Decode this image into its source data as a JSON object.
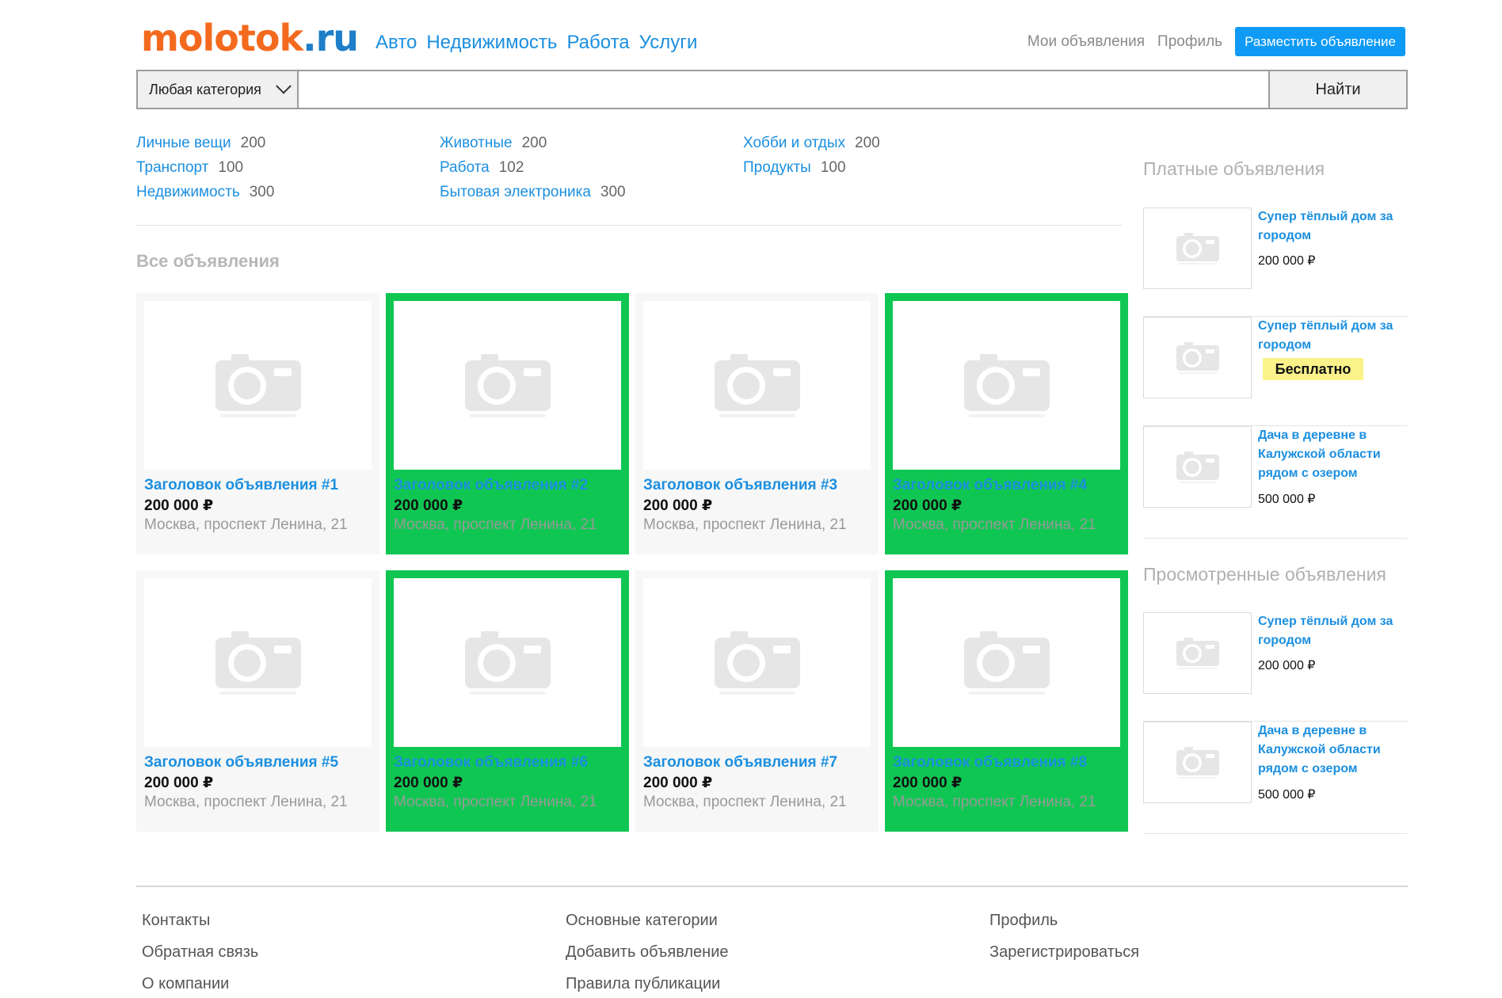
{
  "header": {
    "logo_main": "molotok",
    "logo_tld": ".ru",
    "nav": [
      "Авто",
      "Недвижимость",
      "Работа",
      "Услуги"
    ],
    "my_ads": "Мои объявления",
    "profile": "Профиль",
    "post_ad": "Разместить объявление"
  },
  "search": {
    "category": "Любая категория",
    "query": "",
    "button": "Найти"
  },
  "categories": [
    [
      {
        "name": "Личные вещи",
        "count": "200"
      },
      {
        "name": "Транспорт",
        "count": "100"
      },
      {
        "name": "Недвижимость",
        "count": "300"
      }
    ],
    [
      {
        "name": "Животные",
        "count": "200"
      },
      {
        "name": "Работа",
        "count": "102"
      },
      {
        "name": "Бытовая электроника",
        "count": "300"
      }
    ],
    [
      {
        "name": "Хобби и отдых",
        "count": "200"
      },
      {
        "name": "Продукты",
        "count": "100"
      }
    ]
  ],
  "listings_title": "Все объявления",
  "listings": [
    {
      "title": "Заголовок объявления #1",
      "price": "200 000 ₽",
      "address": "Москва, проспект Ленина, 21",
      "highlighted": false
    },
    {
      "title": "Заголовок объявления #2",
      "price": "200 000 ₽",
      "address": "Москва, проспект Ленина, 21",
      "highlighted": true
    },
    {
      "title": "Заголовок объявления #3",
      "price": "200 000 ₽",
      "address": "Москва, проспект Ленина, 21",
      "highlighted": false
    },
    {
      "title": "Заголовок объявления #4",
      "price": "200 000 ₽",
      "address": "Москва, проспект Ленина, 21",
      "highlighted": true
    },
    {
      "title": "Заголовок объявления #5",
      "price": "200 000 ₽",
      "address": "Москва, проспект Ленина, 21",
      "highlighted": false
    },
    {
      "title": "Заголовок объявления #6",
      "price": "200 000 ₽",
      "address": "Москва, проспект Ленина, 21",
      "highlighted": true
    },
    {
      "title": "Заголовок объявления #7",
      "price": "200 000 ₽",
      "address": "Москва, проспект Ленина, 21",
      "highlighted": false
    },
    {
      "title": "Заголовок объявления #8",
      "price": "200 000 ₽",
      "address": "Москва, проспект Ленина, 21",
      "highlighted": true
    }
  ],
  "sidebar": {
    "paid_title": "Платные объявления",
    "paid": [
      {
        "title": "Супер тёплый дом за городом",
        "price": "200 000 ₽"
      },
      {
        "title": "Супер тёплый дом за городом",
        "badge": "Бесплатно"
      },
      {
        "title": "Дача в деревне в Калужской области рядом с озером",
        "price": "500 000 ₽"
      }
    ],
    "viewed_title": "Просмотренные объявления",
    "viewed": [
      {
        "title": "Супер тёплый дом за городом",
        "price": "200 000 ₽"
      },
      {
        "title": "Дача в деревне в Калужской области рядом с озером",
        "price": "500 000 ₽"
      }
    ]
  },
  "footer": [
    [
      "Контакты",
      "Обратная связь",
      "О компании"
    ],
    [
      "Основные категории",
      "Добавить объявление",
      "Правила публикации"
    ],
    [
      "Профиль",
      "Зарегистрироваться"
    ]
  ],
  "colors": {
    "accent": "#1b8fe0",
    "logo": "#f36a1e",
    "highlight": "#10c653",
    "button": "#0e9af5",
    "badge": "#fbf38a"
  },
  "icons": {
    "placeholder": "camera-icon",
    "dropdown": "chevron-down-icon"
  }
}
